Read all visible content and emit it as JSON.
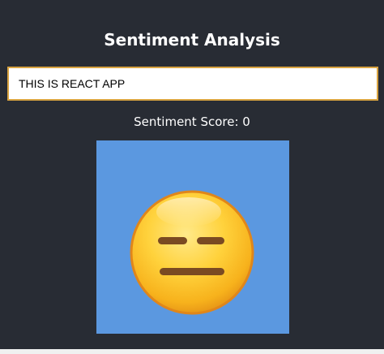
{
  "header": {
    "title": "Sentiment Analysis"
  },
  "input": {
    "value": "THIS IS REACT APP"
  },
  "result": {
    "label": "Sentiment Score: 0",
    "score": 0
  },
  "emoji": {
    "name": "expressionless-face-icon",
    "background_color": "#5b98e0"
  },
  "colors": {
    "app_background": "#282c34",
    "input_border": "#d9a441"
  }
}
